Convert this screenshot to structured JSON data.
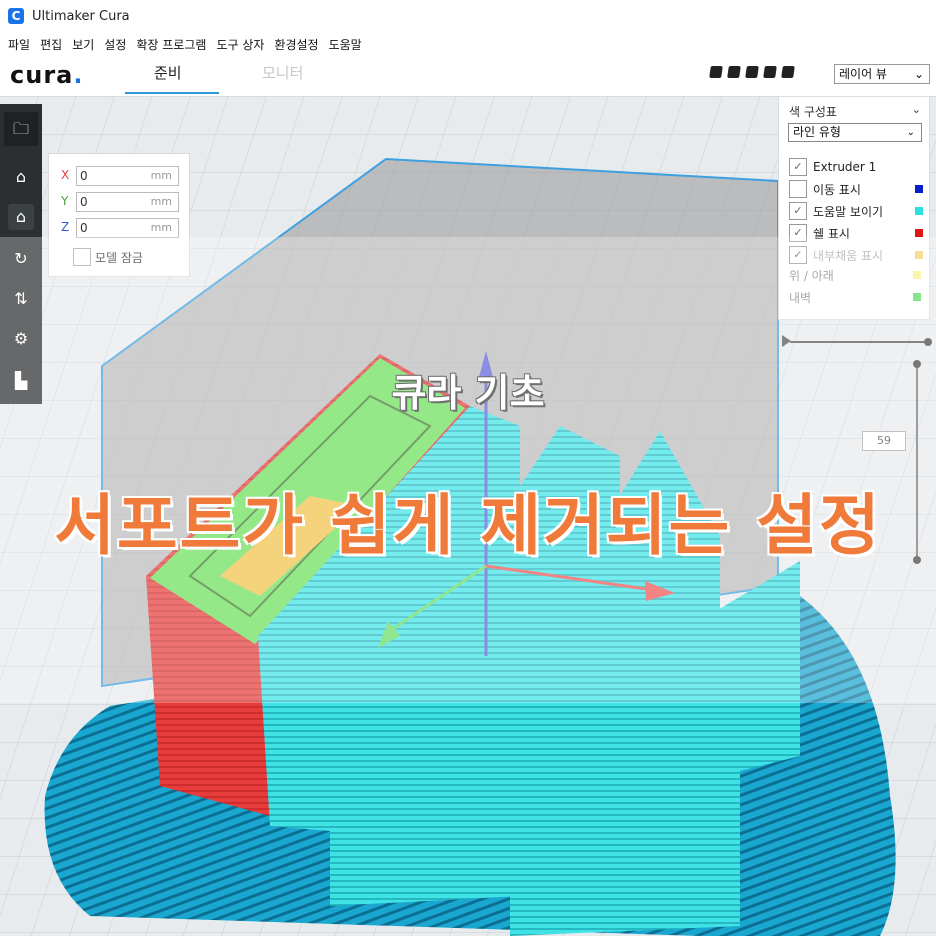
{
  "window": {
    "title": "Ultimaker Cura",
    "icon": "cura-app-icon"
  },
  "menu": {
    "items": [
      "파일",
      "편집",
      "보기",
      "설정",
      "확장 프로그램",
      "도구 상자",
      "환경설정",
      "도움말"
    ]
  },
  "topbar": {
    "logo": "cura",
    "tabs": [
      {
        "label": "준비",
        "active": true
      },
      {
        "label": "모니터",
        "active": false
      }
    ],
    "view_mode": "레이어 뷰"
  },
  "move_panel": {
    "x_label": "X",
    "x_value": "0",
    "y_label": "Y",
    "y_value": "0",
    "z_label": "Z",
    "z_value": "0",
    "unit": "mm",
    "lock_label": "모델 잠금"
  },
  "color_scheme": {
    "title": "색 구성표",
    "selected": "라인 유형",
    "rows": [
      {
        "label": "Extruder 1",
        "checked": true,
        "color": ""
      },
      {
        "label": "이동 표시",
        "checked": false,
        "color": "#0a1ec8"
      },
      {
        "label": "도움말 보이기",
        "checked": true,
        "color": "#2ee0e0"
      },
      {
        "label": "쉘 표시",
        "checked": true,
        "color": "#e01818"
      },
      {
        "label": "내부채움 표시",
        "checked": true,
        "color": "#f0d070"
      }
    ],
    "plain_rows": [
      {
        "label": "위 / 아래",
        "color": "#f8f28c"
      },
      {
        "label": "내벽",
        "color": "#55dd55"
      }
    ]
  },
  "layer_slider": {
    "current_layer": "59"
  },
  "overlay": {
    "subtitle": "큐라 기초",
    "headline": "서포트가 쉽게 제거되는 설정"
  },
  "colors": {
    "shell": "#e73c3c",
    "support": "#3fe3e6",
    "infill": "#f0c24a",
    "top_bottom": "#7ee04a",
    "accent": "#2d9ad8"
  }
}
